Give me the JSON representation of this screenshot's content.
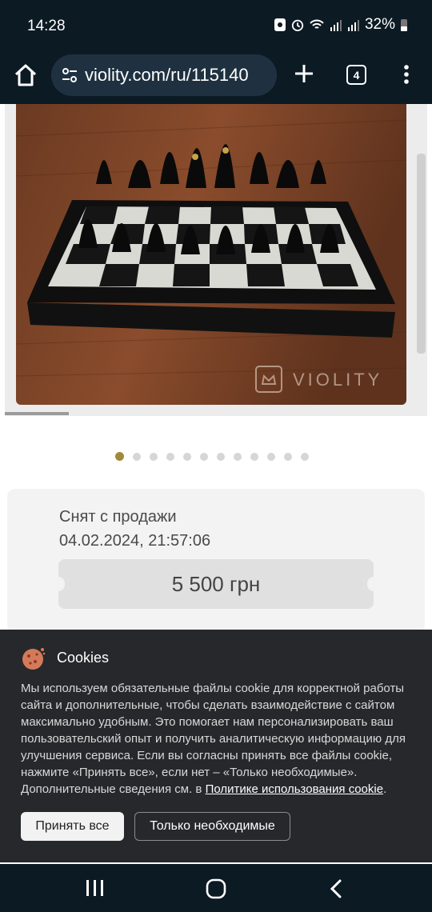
{
  "status": {
    "time": "14:28",
    "battery": "32%"
  },
  "browser": {
    "url": "violity.com/ru/115140",
    "tab_count": "4"
  },
  "gallery": {
    "watermark": "VIOLITY",
    "dot_count": 12,
    "active_index": 0
  },
  "lot": {
    "status": "Снят с продажи",
    "date": "04.02.2024, 21:57:06",
    "price": "5 500 грн"
  },
  "cookie": {
    "title": "Cookies",
    "body": "Мы используем обязательные файлы cookie для корректной работы сайта и дополнительные, чтобы сделать взаимодействие с сайтом максимально удобным. Это помогает нам персонализировать ваш пользовательский опыт и получить аналитическую информацию для улучшения сервиса. Если вы согласны принять все файлы cookie, нажмите «Принять все», если нет – «Только необходимые». Дополнительные сведения см. в ",
    "link": "Политике использования cookie",
    "tail": ".",
    "accept_label": "Принять все",
    "necessary_label": "Только необходимые"
  },
  "colors": {
    "accent": "#a08a3a",
    "dark_bar": "#0c1a24",
    "cookie_bg": "#26282b"
  }
}
